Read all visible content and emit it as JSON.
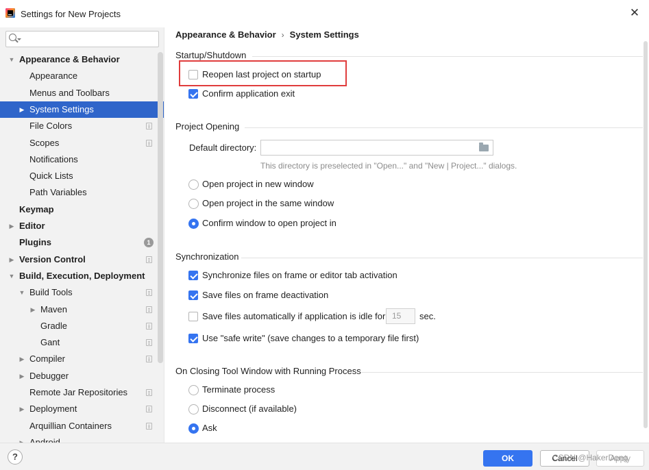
{
  "window": {
    "title": "Settings for New Projects"
  },
  "search": {
    "placeholder": "",
    "value": ""
  },
  "sidebar": {
    "items": [
      {
        "label": "Appearance & Behavior",
        "bold": true,
        "arrow": "down",
        "level": 0
      },
      {
        "label": "Appearance",
        "level": 1
      },
      {
        "label": "Menus and Toolbars",
        "level": 1
      },
      {
        "label": "System Settings",
        "level": 1,
        "arrow": "right",
        "selected": true
      },
      {
        "label": "File Colors",
        "level": 1,
        "proj": true
      },
      {
        "label": "Scopes",
        "level": 1,
        "proj": true
      },
      {
        "label": "Notifications",
        "level": 1
      },
      {
        "label": "Quick Lists",
        "level": 1
      },
      {
        "label": "Path Variables",
        "level": 1
      },
      {
        "label": "Keymap",
        "bold": true,
        "level": 0
      },
      {
        "label": "Editor",
        "bold": true,
        "arrow": "right",
        "level": 0
      },
      {
        "label": "Plugins",
        "bold": true,
        "level": 0,
        "badge": "1"
      },
      {
        "label": "Version Control",
        "bold": true,
        "arrow": "right",
        "level": 0,
        "proj": true
      },
      {
        "label": "Build, Execution, Deployment",
        "bold": true,
        "arrow": "down",
        "level": 0
      },
      {
        "label": "Build Tools",
        "level": 1,
        "arrow": "down",
        "proj": true
      },
      {
        "label": "Maven",
        "level": 2,
        "arrow": "right",
        "proj": true
      },
      {
        "label": "Gradle",
        "level": 2,
        "proj": true
      },
      {
        "label": "Gant",
        "level": 2,
        "proj": true
      },
      {
        "label": "Compiler",
        "level": 1,
        "arrow": "right",
        "proj": true
      },
      {
        "label": "Debugger",
        "level": 1,
        "arrow": "right"
      },
      {
        "label": "Remote Jar Repositories",
        "level": 1,
        "proj": true
      },
      {
        "label": "Deployment",
        "level": 1,
        "arrow": "right",
        "proj": true
      },
      {
        "label": "Arquillian Containers",
        "level": 1,
        "proj": true
      },
      {
        "label": "Android",
        "level": 1,
        "arrow": "right"
      }
    ]
  },
  "breadcrumb": {
    "parent": "Appearance & Behavior",
    "separator": "›",
    "current": "System Settings"
  },
  "startup": {
    "title": "Startup/Shutdown",
    "reopen_label": "Reopen last project on startup",
    "reopen_checked": false,
    "confirm_exit_label": "Confirm application exit",
    "confirm_exit_checked": true
  },
  "project_opening": {
    "title": "Project Opening",
    "default_dir_label": "Default directory:",
    "default_dir_value": "",
    "hint": "This directory is preselected in \"Open...\" and \"New | Project...\" dialogs.",
    "options": [
      {
        "label": "Open project in new window",
        "checked": false
      },
      {
        "label": "Open project in the same window",
        "checked": false
      },
      {
        "label": "Confirm window to open project in",
        "checked": true
      }
    ]
  },
  "synchronization": {
    "title": "Synchronization",
    "sync_files_label": "Synchronize files on frame or editor tab activation",
    "sync_files_checked": true,
    "save_deactivation_label": "Save files on frame deactivation",
    "save_deactivation_checked": true,
    "save_idle_label": "Save files automatically if application is idle for",
    "save_idle_checked": false,
    "idle_value": "15",
    "idle_unit": "sec.",
    "safe_write_label": "Use \"safe write\" (save changes to a temporary file first)",
    "safe_write_checked": true
  },
  "closing": {
    "title": "On Closing Tool Window with Running Process",
    "options": [
      {
        "label": "Terminate process",
        "checked": false
      },
      {
        "label": "Disconnect (if available)",
        "checked": false
      },
      {
        "label": "Ask",
        "checked": true
      }
    ]
  },
  "footer": {
    "help_label": "?",
    "ok_label": "OK",
    "cancel_label": "Cancel",
    "apply_label": "Apply",
    "watermark": "CSDN @HakerDong"
  },
  "colors": {
    "accent": "#3574f0",
    "selection": "#2f65ca",
    "highlight_box": "#e03c3c"
  }
}
